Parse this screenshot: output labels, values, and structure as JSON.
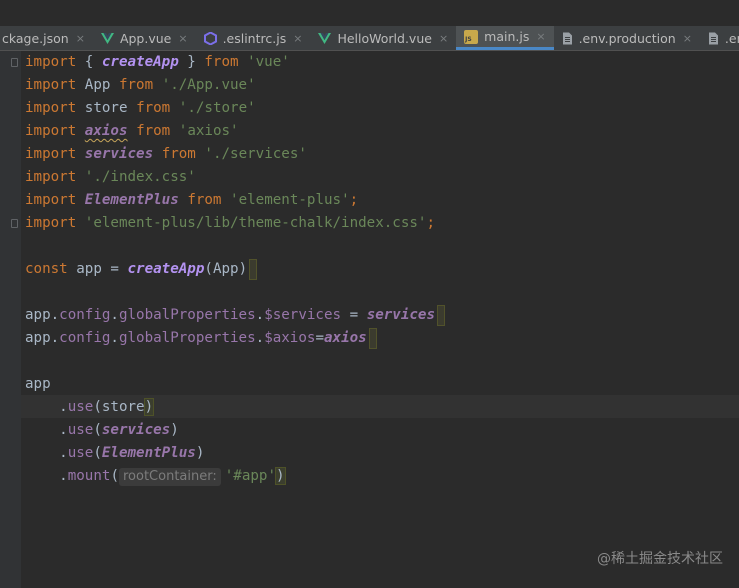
{
  "tabs": [
    {
      "label": "ckage.json",
      "icon": "json-file-icon",
      "active": false
    },
    {
      "label": "App.vue",
      "icon": "vue-icon",
      "active": false
    },
    {
      "label": ".eslintrc.js",
      "icon": "eslint-icon",
      "active": false
    },
    {
      "label": "HelloWorld.vue",
      "icon": "vue-icon",
      "active": false
    },
    {
      "label": "main.js",
      "icon": "js-file-icon",
      "active": true
    },
    {
      "label": ".env.production",
      "icon": "text-file-icon",
      "active": false
    },
    {
      "label": ".env.d",
      "icon": "text-file-icon",
      "active": false
    }
  ],
  "js_icon_text": "JS",
  "close_glyph": "×",
  "code": {
    "imports": [
      {
        "kw1": "import",
        "pre": " { ",
        "name": "createApp",
        "post": " } ",
        "kw2": "from",
        "src": "'vue'"
      },
      {
        "kw1": "import",
        "name": "App",
        "kw2": "from",
        "src": "'./App.vue'"
      },
      {
        "kw1": "import",
        "name": "store",
        "kw2": "from",
        "src": "'./store'"
      },
      {
        "kw1": "import",
        "name": "axios",
        "kw2": "from",
        "src": "'axios'"
      },
      {
        "kw1": "import",
        "name": "services",
        "kw2": "from",
        "src": "'./services'"
      },
      {
        "kw1": "import",
        "src": "'./index.css'"
      },
      {
        "kw1": "import",
        "name": "ElementPlus",
        "kw2": "from",
        "src": "'element-plus'",
        "semi": ";"
      },
      {
        "kw1": "import",
        "src": "'element-plus/lib/theme-chalk/index.css'",
        "semi": ";"
      }
    ],
    "const_line": {
      "kw": "const",
      "var": "app",
      "op": " = ",
      "fn": "createApp",
      "open": "(",
      "arg": "App",
      "close": ")"
    },
    "services_line": {
      "obj": "app",
      "dot1": ".",
      "p1": "config",
      "dot2": ".",
      "p2": "globalProperties",
      "dot3": ".",
      "p3": "$services",
      "op": " = ",
      "val": "services"
    },
    "axios_line": {
      "obj": "app",
      "dot1": ".",
      "p1": "config",
      "dot2": ".",
      "p2": "globalProperties",
      "dot3": ".",
      "p3": "$axios",
      "op": "=",
      "val": "axios"
    },
    "app_line": "app",
    "use_store": {
      "dot": ".",
      "method": "use",
      "open": "(",
      "arg": "store",
      "close": ")"
    },
    "use_services": {
      "dot": ".",
      "method": "use",
      "open": "(",
      "arg": "services",
      "close": ")"
    },
    "use_element": {
      "dot": ".",
      "method": "use",
      "open": "(",
      "arg": "ElementPlus",
      "close": ")"
    },
    "mount": {
      "dot": ".",
      "method": "mount",
      "open": "(",
      "hint": "rootContainer:",
      "arg": "'#app'",
      "close": ")"
    }
  },
  "watermark": "@稀土掘金技术社区"
}
